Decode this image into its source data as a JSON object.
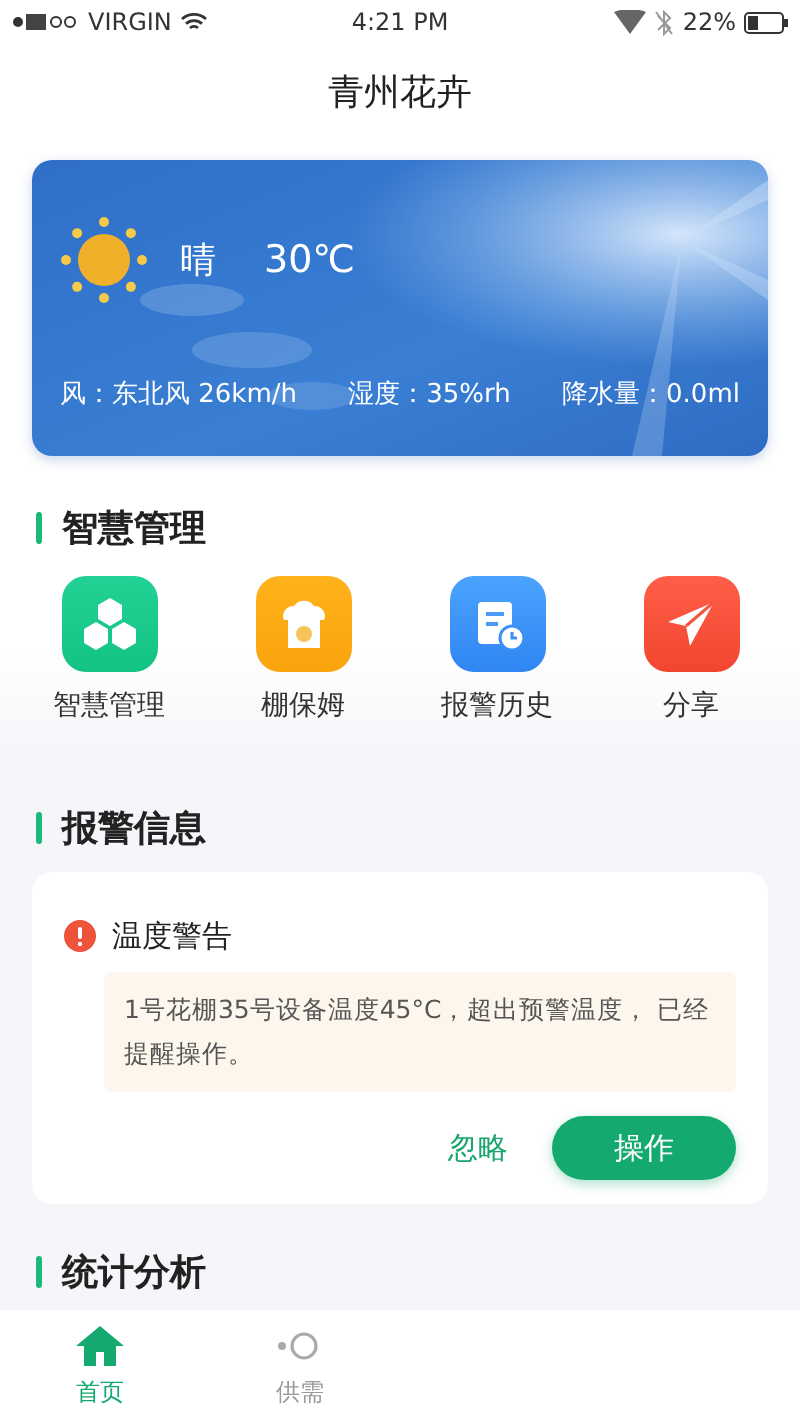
{
  "status_bar": {
    "carrier": "VIRGIN",
    "time": "4:21 PM",
    "battery": "22%"
  },
  "header": {
    "title": "青州花卉"
  },
  "weather": {
    "condition": "晴",
    "temperature": "30℃",
    "details": [
      "风：东北风 26km/h",
      "湿度：35%rh",
      "降水量：0.0ml"
    ]
  },
  "management": {
    "heading": "智慧管理",
    "items": [
      {
        "label": "智慧管理",
        "kind": "hexagons"
      },
      {
        "label": "棚保姆",
        "kind": "nanny"
      },
      {
        "label": "报警历史",
        "kind": "history"
      },
      {
        "label": "分享",
        "kind": "share"
      }
    ]
  },
  "alerts": {
    "heading": "报警信息",
    "items": [
      {
        "title": "温度警告",
        "message": "1号花棚35号设备温度45°C，超出预警温度， 已经提醒操作。",
        "actions": [
          {
            "label": "忽略",
            "kind": "text"
          },
          {
            "label": "操作",
            "kind": "primary"
          }
        ]
      }
    ]
  },
  "statistics": {
    "heading": "统计分析"
  },
  "tab_bar": {
    "tabs": [
      {
        "label": "首页",
        "kind": "home",
        "selected": true
      },
      {
        "label": "供需",
        "kind": "market",
        "selected": false
      }
    ]
  }
}
